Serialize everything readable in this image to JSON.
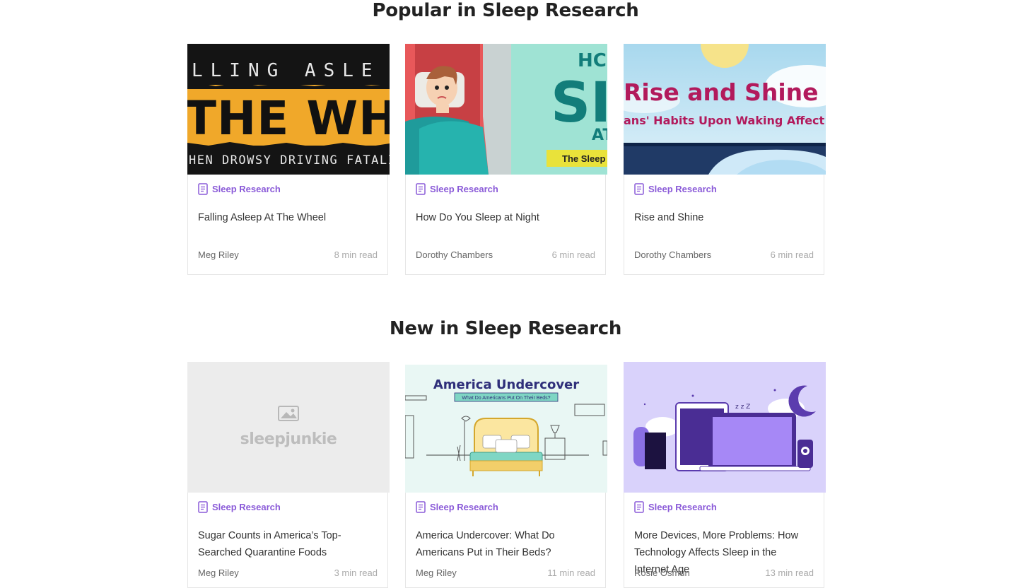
{
  "popular": {
    "heading": "Popular in Sleep Research",
    "cards": [
      {
        "category": "Sleep Research",
        "title": "Falling Asleep At The Wheel",
        "author": "Meg Riley",
        "read_time": "8 min read",
        "image_text": {
          "line1": "LLING ASLE",
          "line2": "THE WH",
          "line3": "HEN DROWSY DRIVING FATALIT"
        }
      },
      {
        "category": "Sleep Research",
        "title": "How Do You Sleep at Night",
        "author": "Dorothy Chambers",
        "read_time": "6 min read",
        "image_text": {
          "line1": "HC",
          "line2": "SI",
          "line3": "AT",
          "banner": "The Sleep I"
        }
      },
      {
        "category": "Sleep Research",
        "title": "Rise and Shine",
        "author": "Dorothy Chambers",
        "read_time": "6 min read",
        "image_text": {
          "line1": "Rise and Shine",
          "line2": "ans' Habits Upon Waking Affect Th"
        }
      }
    ]
  },
  "new": {
    "heading": "New in Sleep Research",
    "cards": [
      {
        "category": "Sleep Research",
        "title": "Sugar Counts in America’s Top-Searched Quarantine Foods",
        "author": "Meg Riley",
        "read_time": "3 min read",
        "image_text": {
          "placeholder_logo": "sleepjunkie"
        }
      },
      {
        "category": "Sleep Research",
        "title": "America Undercover: What Do Americans Put in Their Beds?",
        "author": "Meg Riley",
        "read_time": "11 min read",
        "image_text": {
          "headline": "America Undercover",
          "subhead": "What Do Americans Put On Their Beds?"
        }
      },
      {
        "category": "Sleep Research",
        "title": "More Devices, More Problems: How Technology Affects Sleep in the Internet Age",
        "author": "Rosie Osmun",
        "read_time": "13 min read",
        "image_text": {
          "zzz": "z z Z"
        }
      }
    ]
  },
  "colors": {
    "accent": "#8a5ad8",
    "border": "#e6e6e6",
    "heading": "#222222"
  },
  "icons": {
    "category": "document-icon",
    "placeholder": "image-icon"
  }
}
